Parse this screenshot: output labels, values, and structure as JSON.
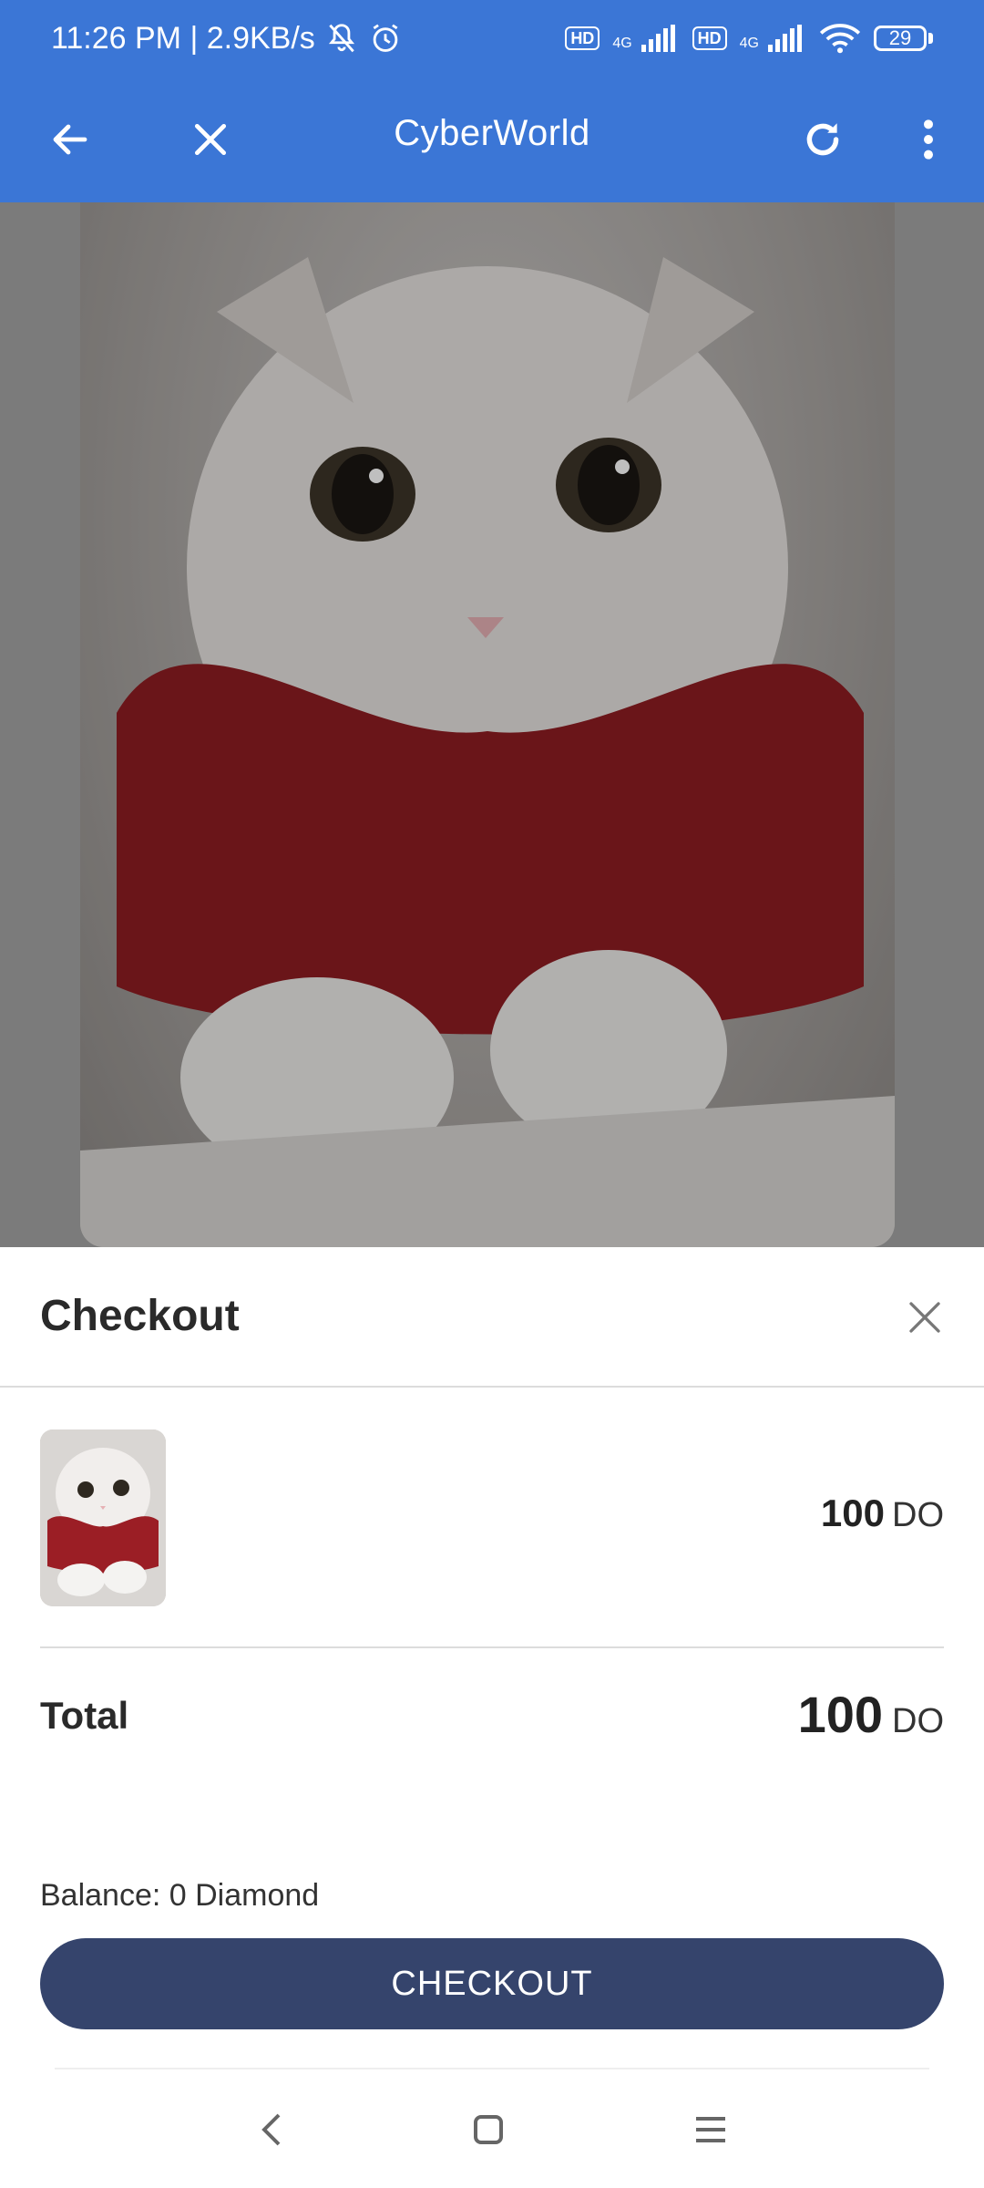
{
  "status_bar": {
    "time_speed": "11:26 PM | 2.9KB/s",
    "hd1": "HD",
    "net1": "4G",
    "hd2": "HD",
    "net2": "4G",
    "battery": "29",
    "icons": [
      "mute-bell-icon",
      "alarm-icon",
      "signal-icon",
      "wifi-icon",
      "battery-icon"
    ]
  },
  "app_bar": {
    "title": "CyberWorld",
    "icons": [
      "back-arrow-icon",
      "close-icon",
      "refresh-icon",
      "more-vert-icon"
    ]
  },
  "checkout": {
    "title": "Checkout",
    "item_price_amount": "100",
    "item_price_currency": "DO",
    "total_label": "Total",
    "total_amount": "100",
    "total_currency": "DO",
    "balance": "Balance:  0 Diamond",
    "button_label": "CHECKOUT"
  },
  "nav_bar": {
    "icons": [
      "nav-back-icon",
      "nav-home-icon",
      "nav-menu-icon"
    ]
  },
  "colors": {
    "app_bar": "#3b76d6",
    "checkout_button": "#35446c"
  }
}
